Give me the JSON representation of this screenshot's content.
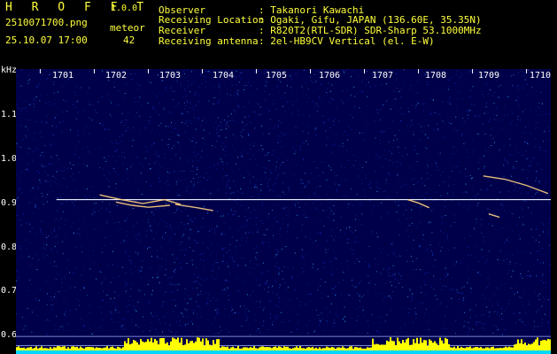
{
  "header": {
    "app_title": "H R O F F T",
    "version": "1.0.0",
    "filename": "2510071700.png",
    "datetime": "25.10.07 17:00",
    "meteor_label": "meteor",
    "meteor_count": "42",
    "info": [
      {
        "key": "Observer",
        "value": ": Takanori Kawachi"
      },
      {
        "key": "Receiving Location",
        "value": ": Ogaki, Gifu, JAPAN (136.60E, 35.35N)"
      },
      {
        "key": "Receiver",
        "value": ": R820T2(RTL-SDR) SDR-Sharp 53.1000MHz"
      },
      {
        "key": "Receiving antenna",
        "value": ": 2el-HB9CV Vertical (el. E-W)"
      }
    ]
  },
  "chart_data": {
    "type": "heatmap",
    "title": "",
    "ylabel": "kHz",
    "xlabel": "",
    "x_ticks": [
      "1701",
      "1702",
      "1703",
      "1704",
      "1705",
      "1706",
      "1707",
      "1708",
      "1709",
      "1710"
    ],
    "y_ticks": [
      "1.1",
      "1.0",
      "0.9",
      "0.8",
      "0.7",
      "0.6"
    ],
    "ylim": [
      0.58,
      1.18
    ],
    "xlim": [
      1700.55,
      1710.45
    ],
    "carrier_khz": 0.905,
    "meteor_traces": [
      {
        "x": [
          1702.1,
          1702.5,
          1702.9,
          1703.3,
          1703.6
        ],
        "y": [
          0.915,
          0.905,
          0.897,
          0.905,
          0.895
        ]
      },
      {
        "x": [
          1702.4,
          1702.7,
          1703.0,
          1703.4
        ],
        "y": [
          0.9,
          0.893,
          0.889,
          0.893
        ]
      },
      {
        "x": [
          1703.5,
          1703.9,
          1704.2
        ],
        "y": [
          0.895,
          0.888,
          0.882
        ]
      },
      {
        "x": [
          1707.8,
          1708.0,
          1708.2
        ],
        "y": [
          0.905,
          0.898,
          0.888
        ]
      },
      {
        "x": [
          1709.2,
          1709.6,
          1710.0,
          1710.4
        ],
        "y": [
          0.955,
          0.948,
          0.935,
          0.918
        ]
      },
      {
        "x": [
          1709.3,
          1709.5
        ],
        "y": [
          0.875,
          0.868
        ]
      }
    ],
    "colors": {
      "background": "#00004a",
      "carrier": "#e8f0ff",
      "meteor": "#ffd080",
      "noise_low": "#1030c0",
      "noise_high": "#30a0ff",
      "floor_band": "#ffff00",
      "floor_base": "#00d8ff"
    }
  }
}
